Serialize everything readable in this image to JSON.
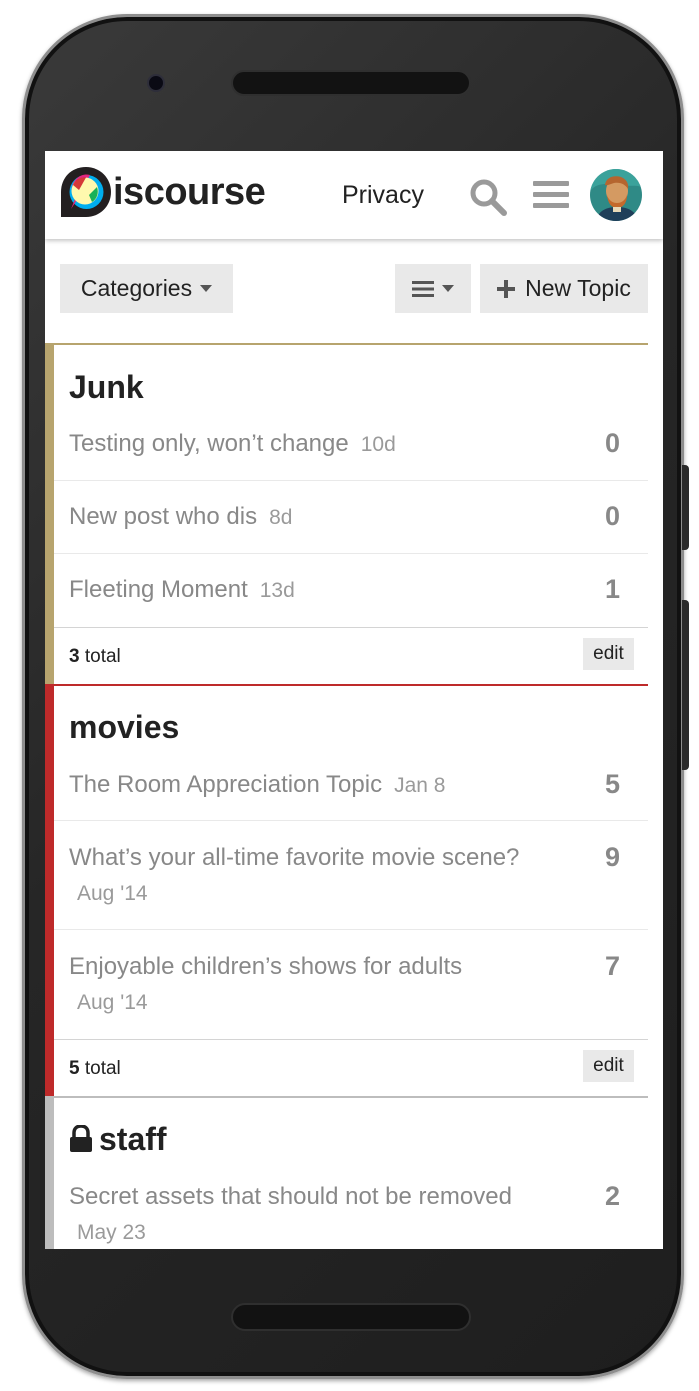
{
  "header": {
    "logo_text": "iscourse",
    "privacy_label": "Privacy"
  },
  "nav": {
    "categories_label": "Categories",
    "new_topic_label": "New Topic"
  },
  "categories": [
    {
      "name": "Junk",
      "color": "#b7a46e",
      "topics": [
        {
          "title": "Testing only, won’t change",
          "age": "10d",
          "count": "0"
        },
        {
          "title": "New post who dis",
          "age": "8d",
          "count": "0"
        },
        {
          "title": "Fleeting Moment",
          "age": "13d",
          "count": "1"
        }
      ],
      "total_count": "3",
      "total_label": "total",
      "edit_label": "edit"
    },
    {
      "name": "movies",
      "color": "#be2a2a",
      "topics": [
        {
          "title": "The Room Appreciation Topic",
          "age": "Jan 8",
          "count": "5"
        },
        {
          "title": "What’s your all-time favorite movie scene?",
          "age": "Aug '14",
          "count": "9"
        },
        {
          "title": "Enjoyable children’s shows for adults",
          "age": "Aug '14",
          "count": "7"
        }
      ],
      "total_count": "5",
      "total_label": "total",
      "edit_label": "edit"
    },
    {
      "name": "staff",
      "color": "#bdbdbd",
      "locked": true,
      "topics": [
        {
          "title": "Secret assets that should not be removed",
          "age": "May 23",
          "count": "2"
        }
      ]
    }
  ],
  "icons": {
    "logo": "discourse-logo-icon",
    "search": "search-icon",
    "menu": "hamburger-menu-icon",
    "avatar": "user-avatar",
    "list": "list-icon",
    "plus": "plus-icon",
    "lock": "lock-icon"
  }
}
